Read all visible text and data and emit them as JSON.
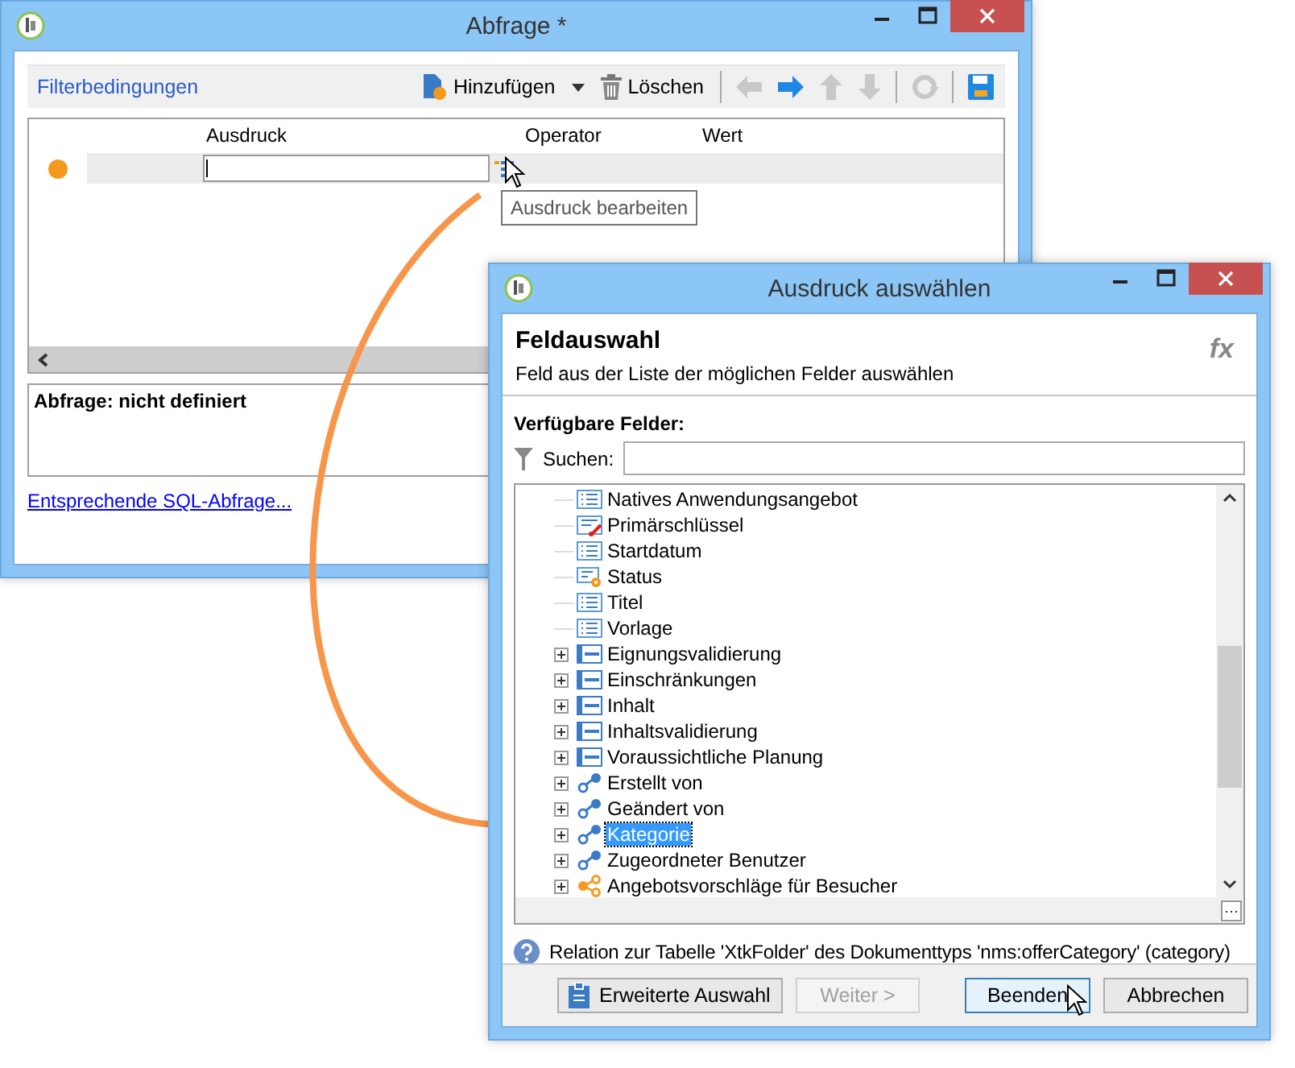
{
  "main_window": {
    "title": "Abfrage *",
    "section_title": "Filterbedingungen",
    "toolbar": [
      {
        "kind": "add",
        "label": "Hinzufügen",
        "disabled": false
      },
      {
        "kind": "delete",
        "label": "Löschen",
        "disabled": false
      },
      {
        "kind": "back",
        "disabled": true
      },
      {
        "kind": "forward",
        "disabled": false
      },
      {
        "kind": "up",
        "disabled": true
      },
      {
        "kind": "down",
        "disabled": true
      },
      {
        "kind": "refresh",
        "disabled": true
      },
      {
        "kind": "save",
        "disabled": false
      }
    ],
    "columns": [
      "Ausdruck",
      "Operator",
      "Wert"
    ],
    "rows": [
      {
        "color": "#f39a1e"
      }
    ],
    "tooltip": "Ausdruck bearbeiten",
    "summary": "Abfrage: nicht definiert",
    "sql_link": "Entsprechende SQL-Abfrage..."
  },
  "dialog": {
    "title": "Ausdruck auswählen",
    "heading": "Feldauswahl",
    "subtitle": "Feld aus der Liste der möglichen Felder auswählen",
    "fx": "fx",
    "fields_label": "Verfügbare Felder:",
    "search_label": "Suchen:",
    "tree": [
      {
        "label": "Natives Anwendungsangebot",
        "kind": "field",
        "expandable": false,
        "selected": false
      },
      {
        "label": "Primärschlüssel",
        "kind": "key",
        "expandable": false,
        "selected": false
      },
      {
        "label": "Startdatum",
        "kind": "field",
        "expandable": false,
        "selected": false
      },
      {
        "label": "Status",
        "kind": "enum",
        "expandable": false,
        "selected": false
      },
      {
        "label": "Titel",
        "kind": "field",
        "expandable": false,
        "selected": false
      },
      {
        "label": "Vorlage",
        "kind": "field",
        "expandable": false,
        "selected": false
      },
      {
        "label": "Eignungsvalidierung",
        "kind": "group",
        "expandable": true,
        "selected": false
      },
      {
        "label": "Einschränkungen",
        "kind": "group",
        "expandable": true,
        "selected": false
      },
      {
        "label": "Inhalt",
        "kind": "group",
        "expandable": true,
        "selected": false
      },
      {
        "label": "Inhaltsvalidierung",
        "kind": "group",
        "expandable": true,
        "selected": false
      },
      {
        "label": "Voraussichtliche Planung",
        "kind": "group",
        "expandable": true,
        "selected": false
      },
      {
        "label": "Erstellt von",
        "kind": "link",
        "expandable": true,
        "selected": false
      },
      {
        "label": "Geändert von",
        "kind": "link",
        "expandable": true,
        "selected": false
      },
      {
        "label": "Kategorie",
        "kind": "link",
        "expandable": true,
        "selected": true
      },
      {
        "label": "Zugeordneter Benutzer",
        "kind": "link",
        "expandable": true,
        "selected": false
      },
      {
        "label": "Angebotsvorschläge für Besucher",
        "kind": "collection",
        "expandable": true,
        "selected": false
      }
    ],
    "help": "Relation zur Tabelle 'XtkFolder' des Dokumenttyps 'nms:offerCategory' (category)",
    "buttons": [
      {
        "label": "Erweiterte Auswahl",
        "kind": "advanced",
        "disabled": false,
        "default": false
      },
      {
        "label": "Weiter >",
        "kind": "next",
        "disabled": true,
        "default": false
      },
      {
        "label": "Beenden",
        "kind": "finish",
        "disabled": false,
        "default": true
      },
      {
        "label": "Abbrechen",
        "kind": "cancel",
        "disabled": false,
        "default": false
      }
    ]
  }
}
